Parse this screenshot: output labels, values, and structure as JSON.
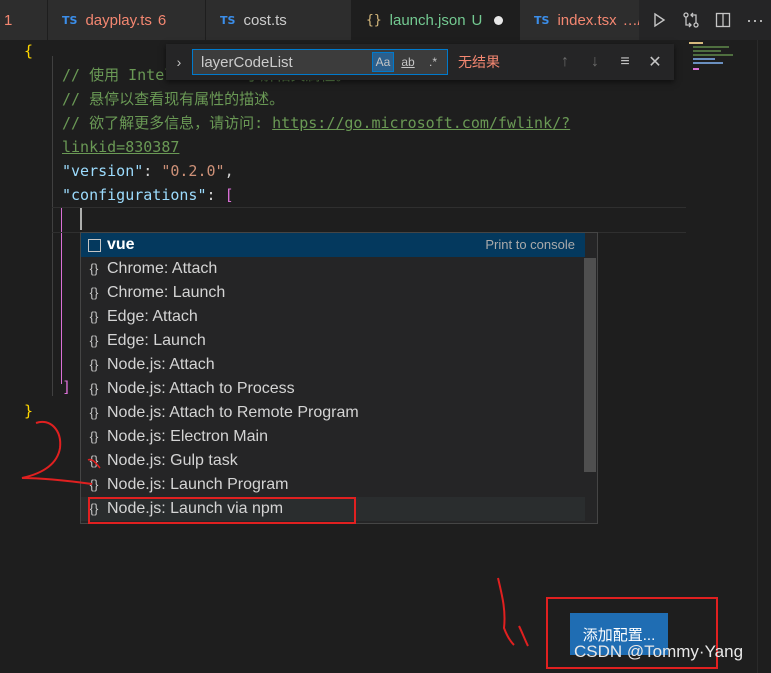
{
  "tabs": [
    {
      "title": "1"
    },
    {
      "badge": "TS",
      "title": "dayplay.ts",
      "problems": "6"
    },
    {
      "badge": "TS",
      "title": "cost.ts"
    },
    {
      "badge": "{}",
      "title": "launch.json",
      "flag": "U"
    },
    {
      "badge": "TS",
      "title": "index.tsx",
      "path": "…/"
    }
  ],
  "find": {
    "query": "layerCodeList",
    "option_case": "Aa",
    "option_word": "ab",
    "option_regex": ".*",
    "result": "无结果"
  },
  "code": {
    "open_brace": "{",
    "comment1": "// 使用 IntelliSense 了解相关属性。",
    "comment2": "// 悬停以查看现有属性的描述。",
    "comment3_text": "// 欲了解更多信息，请访问: ",
    "comment3_link": "https://go.microsoft.com/fwlink/?",
    "comment4_link": "linkid=830387",
    "version_key": "\"version\"",
    "version_val": "\"0.2.0\"",
    "colon": ": ",
    "comma": ",",
    "configs_key": "\"configurations\"",
    "open_bracket": "[",
    "close_bracket": "]",
    "close_brace": "}"
  },
  "suggest": {
    "items": [
      {
        "label": "vue",
        "detail": "Print to console",
        "icon": "snippet"
      },
      {
        "label": "Chrome: Attach",
        "icon": "braces"
      },
      {
        "label": "Chrome: Launch",
        "icon": "braces"
      },
      {
        "label": "Edge: Attach",
        "icon": "braces"
      },
      {
        "label": "Edge: Launch",
        "icon": "braces"
      },
      {
        "label": "Node.js: Attach",
        "icon": "braces"
      },
      {
        "label": "Node.js: Attach to Process",
        "icon": "braces"
      },
      {
        "label": "Node.js: Attach to Remote Program",
        "icon": "braces"
      },
      {
        "label": "Node.js: Electron Main",
        "icon": "braces"
      },
      {
        "label": "Node.js: Gulp task",
        "icon": "braces"
      },
      {
        "label": "Node.js: Launch Program",
        "icon": "braces"
      },
      {
        "label": "Node.js: Launch via npm",
        "icon": "braces"
      }
    ]
  },
  "add_config_button": "添加配置...",
  "watermark": "CSDN @Tommy·Yang",
  "colors": {
    "accent": "#007acc",
    "selection": "#04395e",
    "button": "#1f6db3",
    "annotation": "#e02020"
  }
}
